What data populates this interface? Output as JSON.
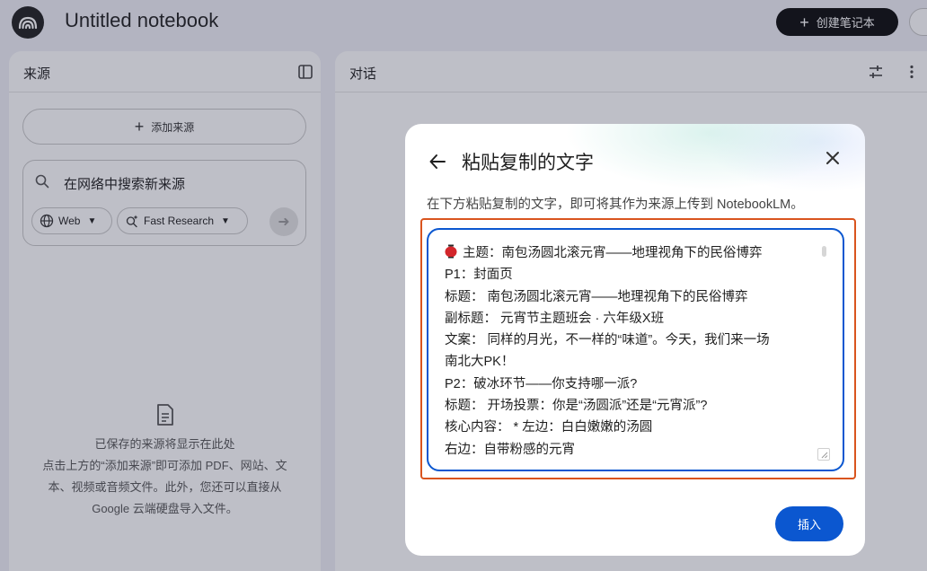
{
  "app": {
    "notebook_title": "Untitled notebook",
    "create_notebook_label": "创建笔记本"
  },
  "sources_panel": {
    "title": "来源",
    "add_source_label": "添加来源",
    "search_placeholder": "在网络中搜索新来源",
    "chip_web_label": "Web",
    "chip_fast_research_label": "Fast Research",
    "empty_state": [
      "已保存的来源将显示在此处",
      "点击上方的“添加来源”即可添加 PDF、网站、文",
      "本、视频或音频文件。此外，您还可以直接从",
      "Google 云端硬盘导入文件。"
    ]
  },
  "chat_panel": {
    "title": "对话"
  },
  "dialog": {
    "title": "粘贴复制的文字",
    "description": "在下方粘贴复制的文字，即可将其作为来源上传到 NotebookLM。",
    "textarea_lines": [
      "主题：南包汤圆北滚元宵——地理视角下的民俗博弈",
      "P1：封面页",
      "标题： 南包汤圆北滚元宵——地理视角下的民俗博弈",
      "副标题： 元宵节主题班会 · 六年级X班",
      "文案： 同样的月光，不一样的“味道”。今天，我们来一场",
      "南北大PK！",
      "P2：破冰环节——你支持哪一派?",
      "标题： 开场投票：你是“汤圆派”还是“元宵派”?",
      "核心内容： * 左边：白白嫩嫩的汤圆",
      "右边：自带粉感的元宵"
    ],
    "insert_label": "插入"
  },
  "colors": {
    "accent_blue": "#0b57d0",
    "highlight_orange": "#d9541e",
    "dark_button": "#0b0b0b"
  }
}
